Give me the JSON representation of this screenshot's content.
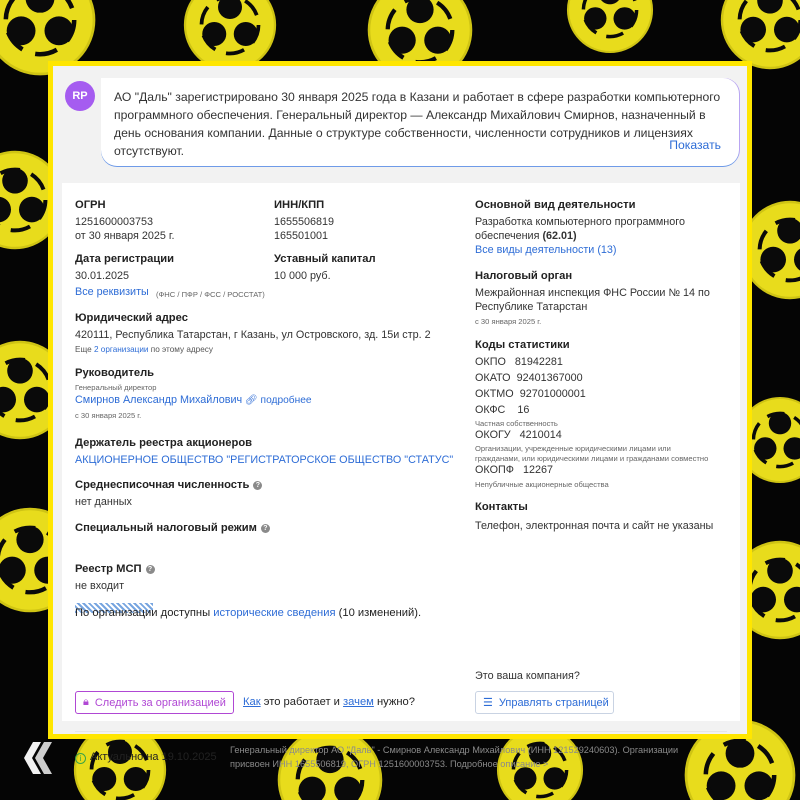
{
  "summary": {
    "avatar": "RP",
    "line1": "АО \"Даль\" зарегистрировано 30 января 2025 года в Казани и работает в сфере разработки компьютерного",
    "line2": "программного обеспечения. Генеральный директор — Александр Михайлович Смирнов, назначенный в",
    "line3": "день основания компании. Данные о структуре собственности, численности сотрудников и лицензиях",
    "line4": "отсутствуют.",
    "show_link": "Показать"
  },
  "ogrn": {
    "label": "ОГРН",
    "value": "1251600003753",
    "date": "от 30 января 2025 г."
  },
  "inn": {
    "label": "ИНН/КПП",
    "inn": "1655506819",
    "kpp": "165501001"
  },
  "reg_date": {
    "label": "Дата регистрации",
    "value": "30.01.2025"
  },
  "capital": {
    "label": "Уставный капитал",
    "value": "10 000 руб."
  },
  "requisites": {
    "link": "Все реквизиты",
    "note": "(ФНС / ПФР / ФСС / РОССТАТ)"
  },
  "address": {
    "label": "Юридический адрес",
    "value": "420111, Республика Татарстан, г Казань, ул Островского, зд. 15и стр. 2",
    "more_prefix": "Еще",
    "more_link": "2 организации",
    "more_suffix": "по этому адресу"
  },
  "director": {
    "label": "Руководитель",
    "role": "Генеральный директор",
    "name": "Смирнов Александр Михайлович",
    "details": "подробнее",
    "since": "с 30 января 2025 г."
  },
  "registrar": {
    "label": "Держатель реестра акционеров",
    "value": "АКЦИОНЕРНОЕ ОБЩЕСТВО \"РЕГИСТРАТОРСКОЕ ОБЩЕСТВО \"СТАТУС\""
  },
  "headcount": {
    "label": "Среднесписочная численность",
    "value": "нет данных"
  },
  "tax_regime": {
    "label": "Специальный налоговый режим"
  },
  "msp": {
    "label": "Реестр МСП",
    "value": "не входит"
  },
  "history": {
    "prefix": "По организации доступны",
    "link": "исторические сведения",
    "suffix": "(10 изменений)."
  },
  "actions": {
    "track": "Следить за организацией",
    "how_link": "Как",
    "how_mid": "это работает и",
    "why_link": "зачем",
    "why_end": "нужно?",
    "your_company": "Это ваша компания?",
    "manage": "Управлять страницей"
  },
  "activity": {
    "label": "Основной вид деятельности",
    "line1": "Разработка компьютерного программного",
    "line2": "обеспечения",
    "code": "(62.01)",
    "all_link": "Все виды деятельности (13)"
  },
  "tax_authority": {
    "label": "Налоговый орган",
    "line1": "Межрайонная инспекция ФНС России № 14 по",
    "line2": "Республике Татарстан",
    "since": "с 30 января 2025 г."
  },
  "stats": {
    "label": "Коды статистики",
    "okpo_k": "ОКПО",
    "okpo_v": "81942281",
    "okato_k": "ОКАТО",
    "okato_v": "92401367000",
    "oktmo_k": "ОКТМО",
    "oktmo_v": "92701000001",
    "okfs_k": "ОКФС",
    "okfs_v": "16",
    "okfs_note": "Частная собственность",
    "okogu_k": "ОКОГУ",
    "okogu_v": "4210014",
    "okogu_note1": "Организации, учрежденные юридическими лицами или",
    "okogu_note2": "гражданами, или юридическими лицами и гражданами совместно",
    "okopf_k": "ОКОПФ",
    "okopf_v": "12267",
    "okopf_note": "Непубличные акционерные общества"
  },
  "contacts": {
    "label": "Контакты",
    "value": "Телефон, электронная почта и сайт не указаны"
  },
  "footer": {
    "actual": "Актуально на 19.10.2025",
    "line1": "Генеральный директор АО \"Даль\" - Смирнов Александр Михайлович (ИНН 121529240603). Организации",
    "line2": "присвоен ИНН 1655506819, ОГРН 1251600003753. Подробное описание >"
  },
  "colors": {
    "accent_yellow": "#ffe600",
    "link_blue": "#2d6cd6",
    "track_purple": "#b047d4",
    "avatar_purple": "#a55cf0"
  }
}
